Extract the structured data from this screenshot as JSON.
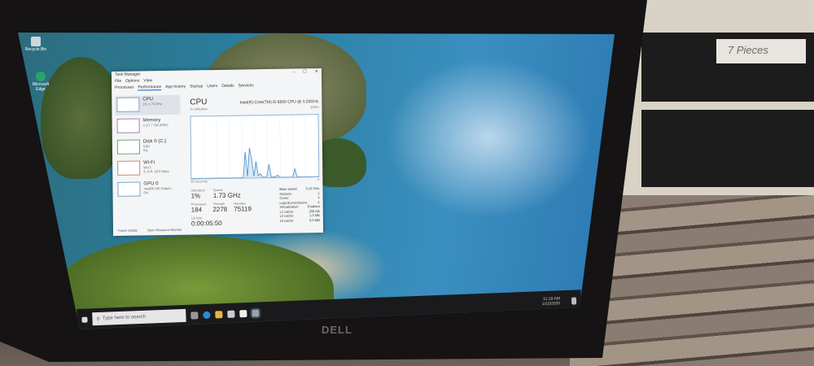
{
  "room": {
    "box_label": "7 Pieces",
    "monitor_brand": "DELL"
  },
  "desktop": {
    "icons": [
      {
        "label": "Recycle Bin"
      },
      {
        "label": "Microsoft Edge"
      }
    ]
  },
  "taskbar": {
    "search_placeholder": "Type here to search",
    "tray_time": "11:18 AM",
    "tray_date": "1/10/2020"
  },
  "task_manager": {
    "title": "Task Manager",
    "menu": [
      "File",
      "Options",
      "View"
    ],
    "tabs": [
      "Processes",
      "Performance",
      "App history",
      "Startup",
      "Users",
      "Details",
      "Services"
    ],
    "active_tab": "Performance",
    "sidebar": [
      {
        "name": "CPU",
        "sub": "1% 1.73 GHz"
      },
      {
        "name": "Memory",
        "sub": "4.1/7.7 GB (53%)"
      },
      {
        "name": "Disk 0 (C:)",
        "sub": "SSD",
        "sub2": "0%"
      },
      {
        "name": "Wi-Fi",
        "sub": "Wi-Fi",
        "sub2": "S: 0 R: 16.0 Kbps"
      },
      {
        "name": "GPU 0",
        "sub": "Intel(R) HD Graphi...",
        "sub2": "0%"
      }
    ],
    "cpu": {
      "heading": "CPU",
      "model": "Intel(R) Core(TM) i5-6500 CPU @ 3.20GHz",
      "graph_label": "% Utilization",
      "graph_max": "100%",
      "graph_time": "60 seconds",
      "graph_min": "0",
      "utilization_label": "Utilization",
      "utilization": "1%",
      "speed_label": "Speed",
      "speed": "1.73 GHz",
      "processes_label": "Processes",
      "processes": "184",
      "threads_label": "Threads",
      "threads": "2278",
      "handles_label": "Handles",
      "handles": "75119",
      "uptime_label": "Up time",
      "uptime": "0:00:05:50",
      "details": [
        {
          "k": "Base speed:",
          "v": "3.19 GHz"
        },
        {
          "k": "Sockets:",
          "v": "1"
        },
        {
          "k": "Cores:",
          "v": "4"
        },
        {
          "k": "Logical processors:",
          "v": "4"
        },
        {
          "k": "Virtualization:",
          "v": "Enabled"
        },
        {
          "k": "L1 cache:",
          "v": "256 KB"
        },
        {
          "k": "L2 cache:",
          "v": "1.0 MB"
        },
        {
          "k": "L3 cache:",
          "v": "6.0 MB"
        }
      ],
      "graph_points": [
        0,
        0,
        0,
        0,
        0,
        0,
        0,
        0,
        0,
        0,
        0,
        0,
        0,
        0,
        0,
        0,
        0,
        0,
        0,
        0,
        0,
        0,
        0,
        0,
        0,
        42,
        2,
        48,
        30,
        2,
        26,
        3,
        6,
        1,
        0,
        2,
        21,
        1,
        0,
        1,
        3,
        0,
        0,
        0,
        0,
        0,
        0,
        0,
        13,
        0,
        0,
        0,
        0,
        0,
        0,
        0,
        0,
        0,
        0,
        0
      ],
      "graph_color": "#4a8cc8"
    },
    "footer": {
      "fewer_details": "Fewer details",
      "resource_monitor": "Open Resource Monitor"
    }
  }
}
